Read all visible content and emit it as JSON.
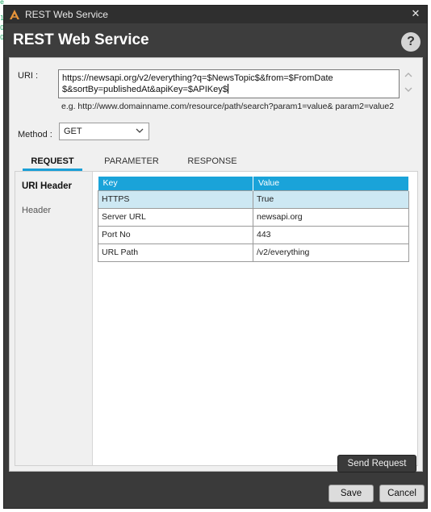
{
  "window": {
    "title": "REST Web Service",
    "close_symbol": "✕",
    "app_icon": "app-logo-icon"
  },
  "edge": {
    "marks": [
      "e",
      "1",
      "0",
      "0"
    ]
  },
  "header": {
    "title": "REST Web Service",
    "help_symbol": "?"
  },
  "uri": {
    "label": "URI :",
    "line1": "https://newsapi.org/v2/everything?q=$NewsTopic$&from=$FromDate",
    "line2": "$&sortBy=publishedAt&apiKey=$APIKey$",
    "example": "e.g. http://www.domainname.com/resource/path/search?param1=value& param2=value2"
  },
  "method": {
    "label": "Method :",
    "selected": "GET"
  },
  "tabs": [
    {
      "label": "REQUEST",
      "active": true
    },
    {
      "label": "PARAMETER",
      "active": false
    },
    {
      "label": "RESPONSE",
      "active": false
    }
  ],
  "left_nav": [
    {
      "label": "URI Header",
      "active": true
    },
    {
      "label": "Header",
      "active": false
    }
  ],
  "table": {
    "headers": [
      "Key",
      "Value"
    ],
    "rows": [
      {
        "key": "HTTPS",
        "value": "True"
      },
      {
        "key": "Server URL",
        "value": "newsapi.org"
      },
      {
        "key": "Port No",
        "value": "443"
      },
      {
        "key": "URL Path",
        "value": "/v2/everything"
      }
    ]
  },
  "buttons": {
    "send_request": "Send Request",
    "save": "Save",
    "cancel": "Cancel"
  },
  "colors": {
    "accent": "#1aa3d9",
    "selected_row": "#cde8f3",
    "dialog_bg": "#3a3a3a"
  }
}
